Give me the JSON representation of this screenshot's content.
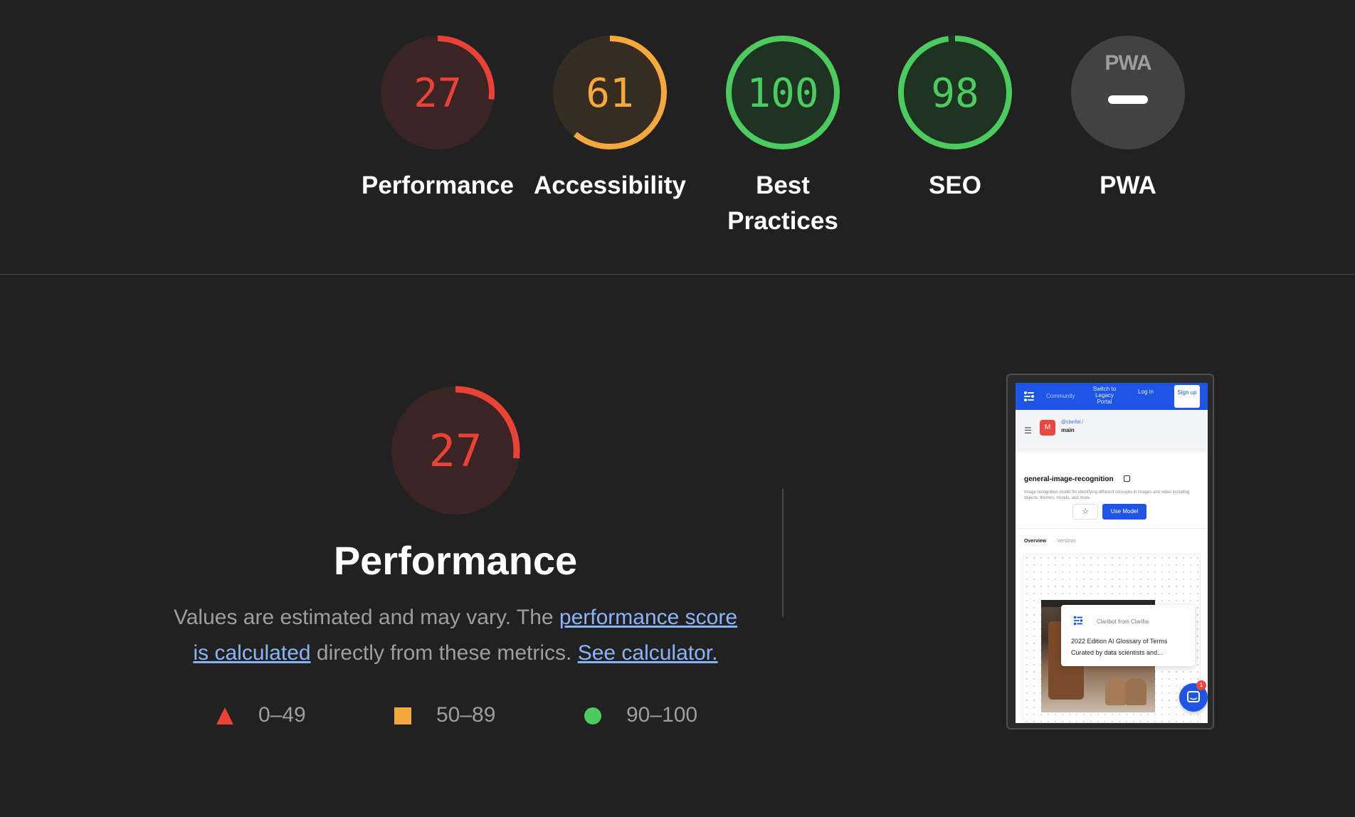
{
  "scores": [
    {
      "label": "Performance",
      "value": "27",
      "fraction": 0.27,
      "rating": "fail"
    },
    {
      "label": "Accessibility",
      "value": "61",
      "fraction": 0.61,
      "rating": "average"
    },
    {
      "label": "Best Practices",
      "value": "100",
      "fraction": 1.0,
      "rating": "pass"
    },
    {
      "label": "SEO",
      "value": "98",
      "fraction": 0.98,
      "rating": "pass"
    },
    {
      "label": "PWA",
      "value": "",
      "fraction": 0,
      "rating": "na",
      "badge": "PWA"
    }
  ],
  "performance": {
    "score": "27",
    "fraction": 0.27,
    "title": "Performance",
    "description_prefix": "Values are estimated and may vary. The ",
    "score_link": "performance score is calculated",
    "description_middle": " directly from these metrics. ",
    "calculator_link": "See calculator."
  },
  "legend": [
    {
      "shape": "triangle",
      "range": "0–49",
      "color": "#ea4335"
    },
    {
      "shape": "square",
      "range": "50–89",
      "color": "#f4a83e"
    },
    {
      "shape": "circle",
      "range": "90–100",
      "color": "#4ccc5e"
    }
  ],
  "colors": {
    "fail": "#ea4335",
    "fail_bg": "#3a2424",
    "average": "#f4a83e",
    "average_bg": "#362c22",
    "pass": "#4ccc5e",
    "pass_bg": "#1f3323",
    "na_bg": "#424242",
    "background": "#212121"
  },
  "screenshot": {
    "nav_community": "Community",
    "nav_switch": "Switch to Legacy Portal",
    "nav_login": "Log in",
    "nav_signup": "Sign up",
    "avatar_letter": "M",
    "org": "@clarifai /",
    "branch": "main",
    "model_title": "general-image-recognition",
    "model_desc": "Image recognition model for identifying different concepts in images and video including objects, themes, moods, and more.",
    "use_model": "Use Model",
    "tab_overview": "Overview",
    "tab_versions": "Versions",
    "chat_name": "Claribot",
    "chat_from": "from Clarifai",
    "chat_line1": "2022 Edition AI Glossary of Terms",
    "chat_line2": "Curated by data scientists and...",
    "badge_count": "1"
  }
}
